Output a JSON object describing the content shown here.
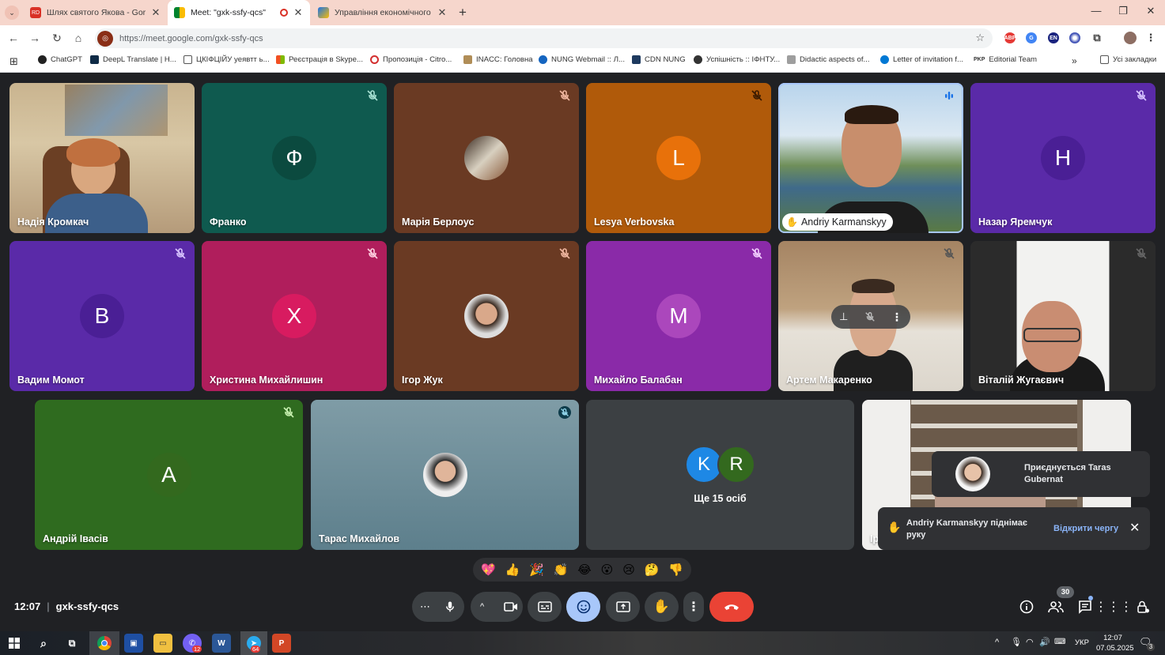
{
  "browser": {
    "tabs": [
      {
        "title": "Шлях святого Якова - Gorgany",
        "icon": "site-favicon",
        "color": "#d93025",
        "active": false
      },
      {
        "title": "Meet: \"gxk-ssfy-qcs\"",
        "icon": "google-meet-icon",
        "color": "#00832d",
        "active": true,
        "recording": true
      },
      {
        "title": "Управління економічного роз",
        "icon": "document-icon",
        "color": "#1a73e8",
        "active": false
      }
    ],
    "url": "https://meet.google.com/gxk-ssfy-qcs",
    "extensions": [
      "ABP",
      "EN"
    ],
    "bookmarks": [
      "ChatGPT",
      "DeepL Translate | H...",
      "ЦКІФЦІЙУ уеявтт ь...",
      "Реєстрація в Skype...",
      "Пропозиція - Citro...",
      "INACC: Головна",
      "NUNG Webmail :: Л...",
      "CDN NUNG",
      "Успішність :: ІФНТУ...",
      "Didactic aspects of...",
      "Letter of invitation f...",
      "Editorial Team"
    ],
    "bookmark_prefix": "PKP",
    "all_bookmarks": "Усі закладки"
  },
  "participants": [
    {
      "name": "Надія Кромкач",
      "type": "video",
      "muted": false
    },
    {
      "name": "Франко",
      "type": "initial",
      "initial": "Ф",
      "muted": true
    },
    {
      "name": "Марія Берлоус",
      "type": "photo",
      "muted": true
    },
    {
      "name": "Lesya Verbovska",
      "type": "initial",
      "initial": "L",
      "muted": true
    },
    {
      "name": "Andriy Karmanskyy",
      "type": "video",
      "muted": false,
      "speaking": true,
      "hand_raised": true
    },
    {
      "name": "Назар Яремчук",
      "type": "initial",
      "initial": "Н",
      "muted": true
    },
    {
      "name": "Вадим Момот",
      "type": "initial",
      "initial": "В",
      "muted": true
    },
    {
      "name": "Христина Михайлишин",
      "type": "initial",
      "initial": "Х",
      "muted": true
    },
    {
      "name": "Ігор Жук",
      "type": "photo",
      "muted": true
    },
    {
      "name": "Михайло Балабан",
      "type": "initial",
      "initial": "М",
      "muted": true
    },
    {
      "name": "Артем Макаренко",
      "type": "video",
      "muted": true,
      "hovered": true
    },
    {
      "name": "Віталій Жугаєвич",
      "type": "video",
      "muted": true
    },
    {
      "name": "Андрій Івасів",
      "type": "initial",
      "initial": "А",
      "muted": true
    },
    {
      "name": "Тарас Михайлов",
      "type": "photo",
      "muted": true
    },
    {
      "name": "Ірина",
      "type": "video",
      "muted": false
    }
  ],
  "more_tile": {
    "initials": [
      "K",
      "R"
    ],
    "label": "Ще 15 осіб"
  },
  "notifications": {
    "join": "Приєднується Taras Gubernat",
    "hand_raise": "Andriy Karmanskyy піднімає руку",
    "open_queue": "Відкрити чергу"
  },
  "reactions": [
    "💖",
    "👍",
    "🎉",
    "👏",
    "😂",
    "😮",
    "😢",
    "🤔",
    "👎"
  ],
  "meeting": {
    "time": "12:07",
    "separator": "|",
    "code": "gxk-ssfy-qcs",
    "participant_count": "30"
  },
  "taskbar": {
    "time": "12:07",
    "date": "07.05.2025",
    "lang": "УКР",
    "viber_badge": "12",
    "telegram_badge": "64",
    "notif_count": "3"
  }
}
